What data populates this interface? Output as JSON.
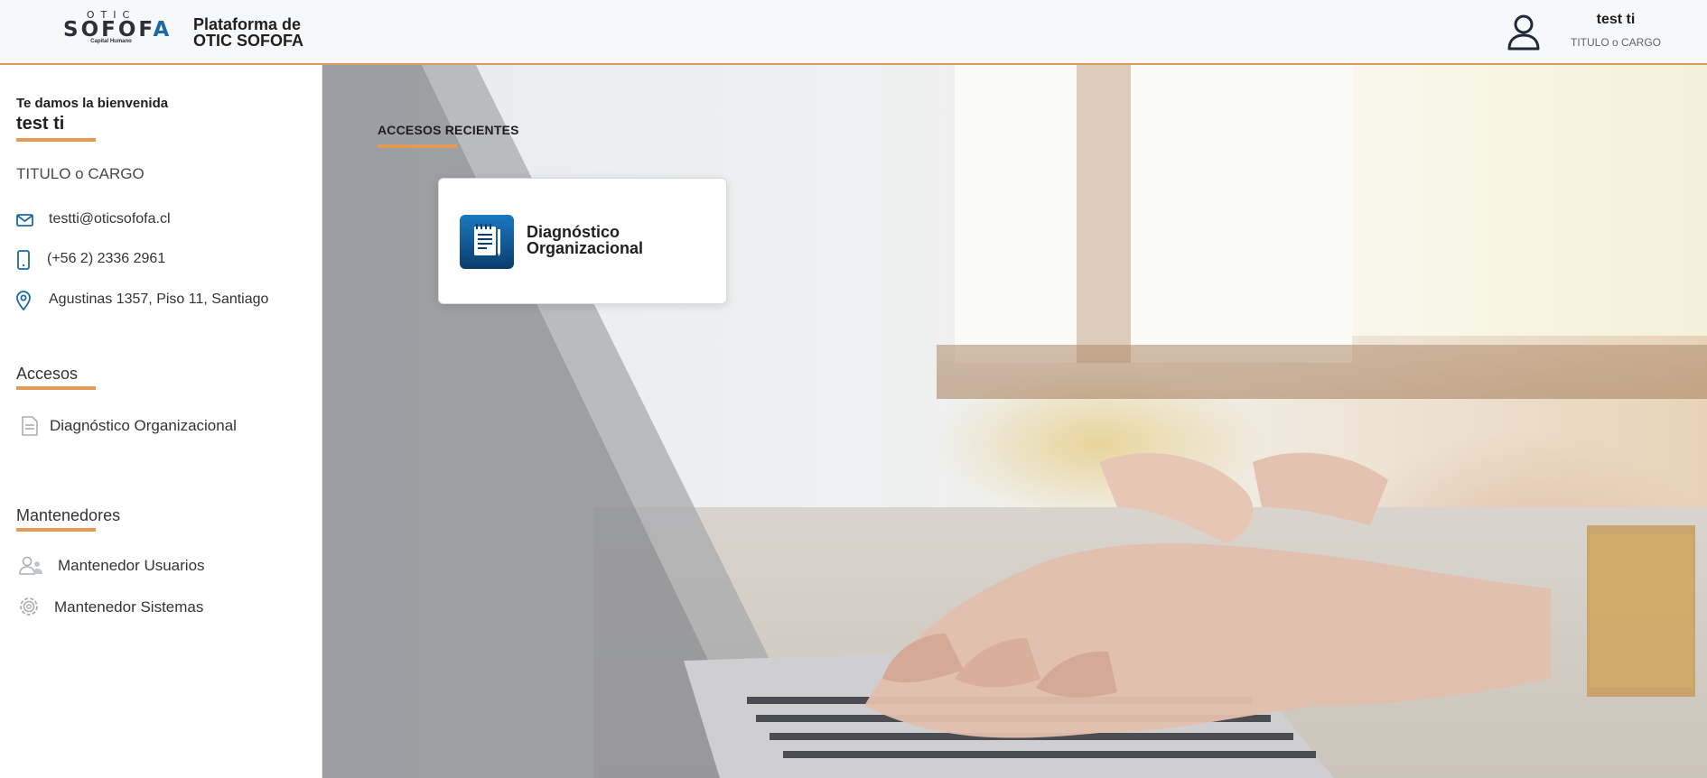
{
  "header": {
    "logo": {
      "top": "OTIC",
      "main_prefix": "SOFOF",
      "main_suffix": "A",
      "tagline": "Capital Humano"
    },
    "platform_line1": "Plataforma de",
    "platform_line2": "OTIC SOFOFA",
    "user": {
      "name": "test ti",
      "title": "TITULO o CARGO",
      "icon": "user-icon"
    }
  },
  "sidebar": {
    "welcome": "Te damos la bienvenida",
    "user_name": "test ti",
    "role": "TITULO o CARGO",
    "contacts": [
      {
        "icon": "mail-icon",
        "text": "testti@oticsofofa.cl"
      },
      {
        "icon": "phone-icon",
        "text": "(+56 2) 2336 2961"
      },
      {
        "icon": "location-pin-icon",
        "text": "Agustinas 1357, Piso 11, Santiago"
      }
    ],
    "accesos": {
      "title": "Accesos",
      "items": [
        {
          "icon": "document-icon",
          "label": "Diagnóstico Organizacional"
        }
      ]
    },
    "mantenedores": {
      "title": "Mantenedores",
      "items": [
        {
          "icon": "users-icon",
          "label": "Mantenedor Usuarios"
        },
        {
          "icon": "gear-icon",
          "label": "Mantenedor Sistemas"
        }
      ]
    }
  },
  "main": {
    "recent_title": "ACCESOS RECIENTES",
    "recent_cards": [
      {
        "icon": "notebook-icon",
        "label_line1": "Diagnóstico",
        "label_line2": "Organizacional"
      }
    ]
  },
  "colors": {
    "accent": "#e29a55",
    "primary": "#1b6aa5",
    "icon_blue": "#1b6aa5",
    "icon_gray": "#a9adb6"
  }
}
